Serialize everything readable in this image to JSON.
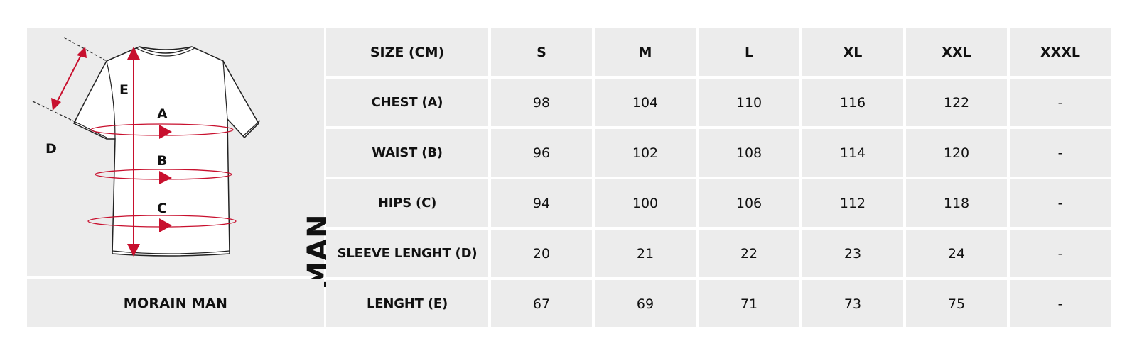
{
  "illustration": {
    "labels": {
      "a": "A",
      "b": "B",
      "c": "C",
      "d": "D",
      "e": "E"
    },
    "accent_color": "#c8102e"
  },
  "side_label": "MAN",
  "product_name": "MORAIN MAN",
  "table": {
    "header": [
      "SIZE (CM)",
      "S",
      "M",
      "L",
      "XL",
      "XXL",
      "XXXL"
    ],
    "rows": [
      {
        "label": "CHEST (A)",
        "values": [
          "98",
          "104",
          "110",
          "116",
          "122",
          "-"
        ]
      },
      {
        "label": "WAIST (B)",
        "values": [
          "96",
          "102",
          "108",
          "114",
          "120",
          "-"
        ]
      },
      {
        "label": "HIPS (C)",
        "values": [
          "94",
          "100",
          "106",
          "112",
          "118",
          "-"
        ]
      },
      {
        "label": "SLEEVE LENGHT (D)",
        "values": [
          "20",
          "21",
          "22",
          "23",
          "24",
          "-"
        ]
      },
      {
        "label": "LENGHT (E)",
        "values": [
          "67",
          "69",
          "71",
          "73",
          "75",
          "-"
        ]
      }
    ]
  }
}
